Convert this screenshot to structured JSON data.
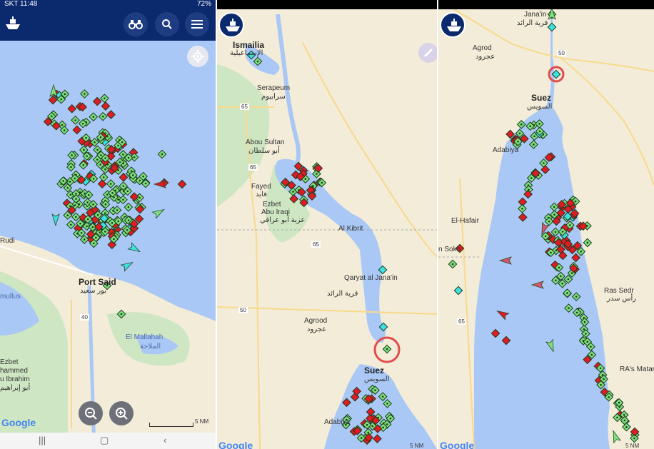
{
  "status_bar": {
    "carrier_time": "SKT 11:48",
    "battery": "72%"
  },
  "panel1": {
    "labels": {
      "port_said_en": "Port Said",
      "port_said_ar": "بور سعيد",
      "el_mallahah_en": "El Mallahah",
      "el_mallahah_ar": "الملاحة",
      "rudi": "Rudi",
      "umullus": "mullus",
      "ezbet": "Ezbet",
      "mohammed": "hammed",
      "ibrahim": "u Ibrahim",
      "ibrahim_ar": "أبو إبراهيم",
      "road_40": "40",
      "scale": "5 NM",
      "google": "Google"
    }
  },
  "panel2": {
    "labels": {
      "ismailia_en": "Ismailia",
      "ismailia_ar": "الإسماعيلية",
      "serapeum_en": "Serapeum",
      "serapeum_ar": "سرابيوم",
      "abou_sultan_en": "Abou Sultan",
      "abou_sultan_ar": "أبو سلطان",
      "fayed_en": "Fayed",
      "fayed_ar": "فايد",
      "ezbet_en": "Ezbet",
      "abu_iraqi_en": "Abu Iraqi",
      "abu_iraqi_ar": "عزبة أبو عراقي",
      "al_kibrit": "Al Kibrit",
      "qaryat_en": "Qaryat al Jana'in",
      "qaryat_ar": "قرية الرائد",
      "agrood_en": "Agrood",
      "agrood_ar": "عجرود",
      "suez_en": "Suez",
      "suez_ar": "السويس",
      "adabiya": "Adabiya",
      "road_65a": "65",
      "road_65b": "65",
      "road_65c": "65",
      "road_50": "50",
      "scale": "5 NM",
      "google": "Google"
    }
  },
  "panel3": {
    "labels": {
      "janain_en": "Jana'in",
      "janain_ar": "قرية الرائد",
      "agrod_en": "Agrod",
      "agrod_ar": "عجرود",
      "suez_en": "Suez",
      "suez_ar": "السويس",
      "adabiya": "Adabiya",
      "el_hafair": "El-Hafair",
      "ras_sedr_en": "Ras Sedr",
      "ras_sedr_ar": "رأس سدر",
      "ras_matarma": "RA's Matar",
      "sokhna": "n Sokh",
      "road_50": "50",
      "road_65": "65",
      "scale": "5 NM",
      "google": "Google"
    }
  },
  "colors": {
    "water": "#aac8f6",
    "land": "#f3ecd8",
    "green_land": "#cfe6c3",
    "ship_cargo": "#7de07d",
    "ship_tanker": "#e01b24",
    "ship_passenger": "#3ee0e0",
    "ship_fishing": "#d8566b",
    "appbar": "#0b2a6e",
    "highlight_circle": "#e34b4b"
  },
  "icons": {
    "logo": "ship-logo-icon",
    "binoculars": "binoculars-icon",
    "search": "search-icon",
    "menu": "hamburger-menu-icon",
    "locate": "crosshair-locate-icon",
    "zoom_out": "zoom-out-icon",
    "zoom_in": "zoom-in-icon",
    "measure": "ruler-icon"
  }
}
